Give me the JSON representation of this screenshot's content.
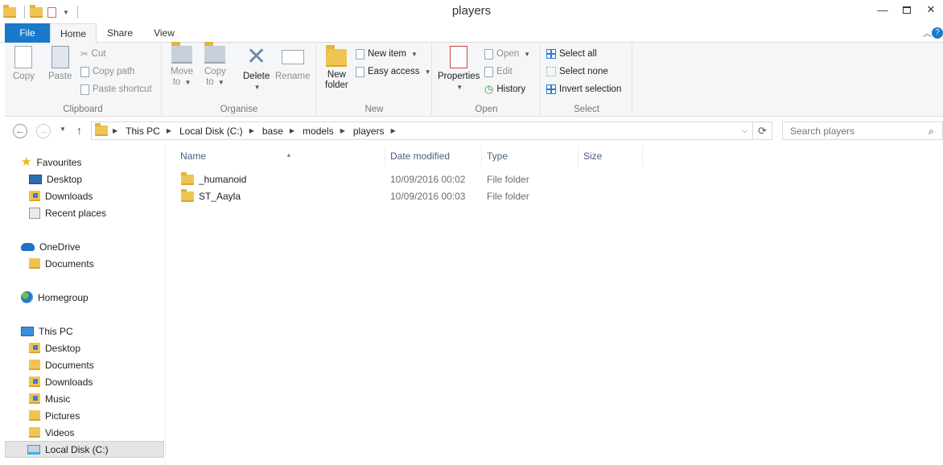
{
  "window": {
    "title": "players"
  },
  "ribbon_tabs": [
    {
      "label": "File"
    },
    {
      "label": "Home"
    },
    {
      "label": "Share"
    },
    {
      "label": "View"
    }
  ],
  "ribbon": {
    "clipboard": {
      "label": "Clipboard",
      "copy": "Copy",
      "paste": "Paste",
      "cut": "Cut",
      "copy_path": "Copy path",
      "paste_shortcut": "Paste shortcut"
    },
    "organise": {
      "label": "Organise",
      "move_to_1": "Move",
      "move_to_2": "to",
      "copy_to_1": "Copy",
      "copy_to_2": "to",
      "delete": "Delete",
      "rename": "Rename"
    },
    "new": {
      "label": "New",
      "new_folder_1": "New",
      "new_folder_2": "folder",
      "new_item": "New item",
      "easy_access": "Easy access"
    },
    "open": {
      "label": "Open",
      "properties": "Properties",
      "open": "Open",
      "edit": "Edit",
      "history": "History"
    },
    "select": {
      "label": "Select",
      "select_all": "Select all",
      "select_none": "Select none",
      "invert_selection": "Invert selection"
    }
  },
  "address": {
    "breadcrumbs": [
      "This PC",
      "Local Disk (C:)",
      "base",
      "models",
      "players"
    ]
  },
  "search": {
    "placeholder": "Search players"
  },
  "nav_pane": {
    "favourites": "Favourites",
    "fav_items": [
      "Desktop",
      "Downloads",
      "Recent places"
    ],
    "onedrive": "OneDrive",
    "onedrive_items": [
      "Documents"
    ],
    "homegroup": "Homegroup",
    "this_pc": "This PC",
    "pc_items": [
      "Desktop",
      "Documents",
      "Downloads",
      "Music",
      "Pictures",
      "Videos",
      "Local Disk (C:)"
    ]
  },
  "columns": {
    "name": "Name",
    "date_modified": "Date modified",
    "type": "Type",
    "size": "Size"
  },
  "files": [
    {
      "name": "_humanoid",
      "date": "10/09/2016 00:02",
      "type": "File folder"
    },
    {
      "name": "ST_Aayla",
      "date": "10/09/2016 00:03",
      "type": "File folder"
    }
  ],
  "colors": {
    "accent": "#1979ca",
    "folder": "#f0c453"
  }
}
